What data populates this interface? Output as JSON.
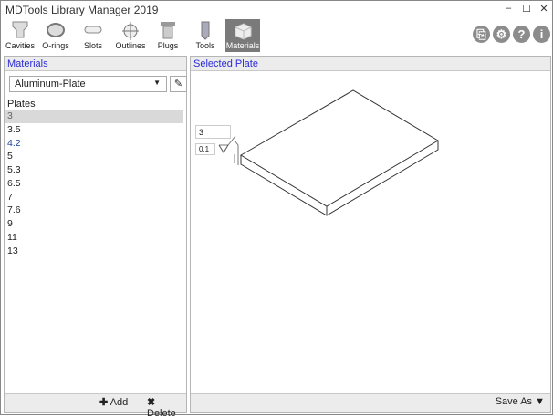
{
  "window": {
    "title": "MDTools Library Manager 2019",
    "minimize": "–",
    "maximize": "☐",
    "close": "✕"
  },
  "toolbar": [
    {
      "label": "Cavities",
      "icon": "cavity-icon"
    },
    {
      "label": "O-rings",
      "icon": "oring-icon"
    },
    {
      "label": "Slots",
      "icon": "slot-icon"
    },
    {
      "label": "Outlines",
      "icon": "outline-icon"
    },
    {
      "label": "Plugs",
      "icon": "plug-icon"
    },
    {
      "label": "Tools",
      "icon": "tool-icon"
    },
    {
      "label": "Materials",
      "icon": "material-icon",
      "active": true
    }
  ],
  "right_buttons": {
    "clipboard": "⎘",
    "settings": "⚙",
    "help": "?",
    "info": "i"
  },
  "materials_panel": {
    "header": "Materials",
    "material": "Aluminum-Plate",
    "plates_label": "Plates",
    "plates": [
      "3",
      "3.5",
      "4.2",
      "5",
      "5.3",
      "6.5",
      "7",
      "7.6",
      "9",
      "11",
      "13"
    ],
    "selected": "3",
    "add": "Add",
    "delete": "Delete"
  },
  "plate_panel": {
    "header": "Selected Plate",
    "thickness": "3",
    "flatness": "0.1",
    "save_as": "Save As"
  }
}
